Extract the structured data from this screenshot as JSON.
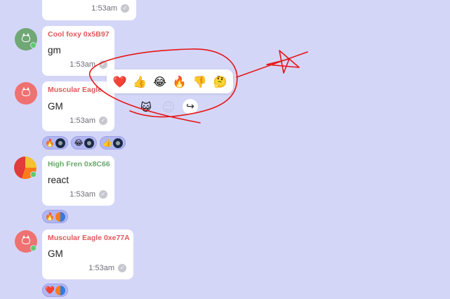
{
  "colors": {
    "background": "#d4d6f8",
    "author_red": "#e0595a",
    "author_green": "#68a66b",
    "annotation": "#e51616"
  },
  "messages": [
    {
      "time": "1:53am"
    },
    {
      "author": "Cool foxy 0x5B97",
      "text": "gm",
      "time": "1:53am",
      "avatar": "fox-avatar-green"
    },
    {
      "author": "Muscular Eagle",
      "text": "GM",
      "time": "1:53am",
      "avatar": "fox-avatar-red",
      "reactions": [
        {
          "emoji": "🔥",
          "user_avatar": "bomb"
        },
        {
          "emoji": "😂",
          "user_avatar": "bomb"
        },
        {
          "emoji": "👍",
          "user_avatar": "bomb"
        }
      ]
    },
    {
      "author": "High Fren 0x8C66",
      "text": "react",
      "time": "1:53am",
      "avatar": "ball-avatar",
      "reactions": [
        {
          "emoji": "🔥",
          "user_avatar": "ball"
        }
      ]
    },
    {
      "author": "Muscular Eagle 0xe77A",
      "text": "GM",
      "time": "1:53am",
      "avatar": "fox-avatar-red",
      "reactions": [
        {
          "emoji": "❤️",
          "user_avatar": "ball"
        }
      ]
    }
  ],
  "reaction_picker": {
    "emojis": [
      "❤️",
      "👍",
      "😂",
      "🔥",
      "👎",
      "🤔"
    ]
  },
  "message_toolbar": {
    "icons": [
      "fox-icon",
      "smiley-icon",
      "forward-icon"
    ],
    "fox": "😺",
    "smiley": "☺",
    "forward": "↪"
  }
}
